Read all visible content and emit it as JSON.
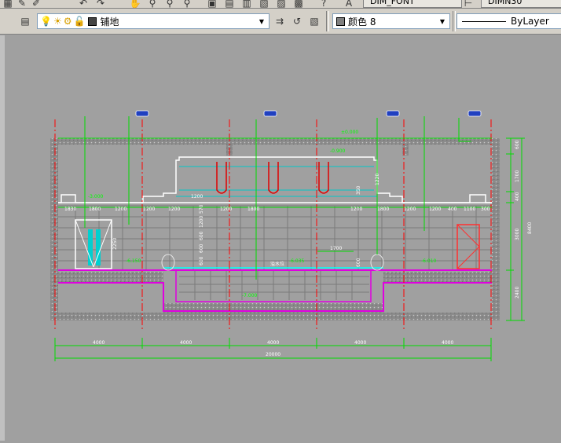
{
  "top_tabs": {
    "dim_font": "DIM_FONT",
    "dim_style": "DIMN30"
  },
  "layer": {
    "name": "铺地"
  },
  "color": {
    "label": "颜色 8"
  },
  "linetype": {
    "label": "ByLayer"
  },
  "drawing": {
    "elevations": [
      "±0.000",
      "-0.900",
      "-3.000",
      "-6.150",
      "-6.035",
      "-6.010",
      "-7.000"
    ],
    "overflow_label": "溢水位",
    "segment_dims_top": [
      "1830",
      "1800",
      "1200",
      "1200",
      "1200",
      "1200",
      "1200",
      "1200",
      "1200",
      "1800",
      "1200",
      "1200",
      "1200",
      "1800",
      "1200",
      "1200",
      "400",
      "1100",
      "300"
    ],
    "vertical_dims_left": [
      "570",
      "1200",
      "600",
      "600",
      "600"
    ],
    "right_dims": [
      "600",
      "1700",
      "400",
      "3000",
      "2400"
    ],
    "right_total": "8400",
    "door_dim": "2250",
    "step_dim": "1700",
    "small_dim": "600",
    "upper_dim_a": "1220",
    "upper_dim_b": "350",
    "bottom_spans": [
      "4000",
      "4000",
      "4000",
      "4000",
      "4000"
    ],
    "bottom_total": "20000"
  }
}
